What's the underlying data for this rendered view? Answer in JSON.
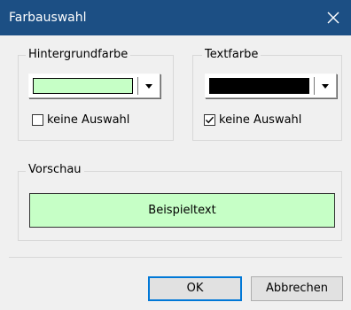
{
  "window": {
    "title": "Farbauswahl",
    "close_icon": "close-icon",
    "title_bar_color": "#1c4f84"
  },
  "background_group": {
    "legend": "Hintergrundfarbe",
    "color": "#c6ffc6",
    "dropdown_icon": "chevron-down-icon",
    "checkbox_label": "keine Auswahl",
    "checked": false
  },
  "text_group": {
    "legend": "Textfarbe",
    "color": "#000000",
    "dropdown_icon": "chevron-down-icon",
    "checkbox_label": "keine Auswahl",
    "checked": true
  },
  "preview_group": {
    "legend": "Vorschau",
    "sample_text": "Beispieltext"
  },
  "buttons": {
    "ok_label": "OK",
    "cancel_label": "Abbrechen"
  }
}
